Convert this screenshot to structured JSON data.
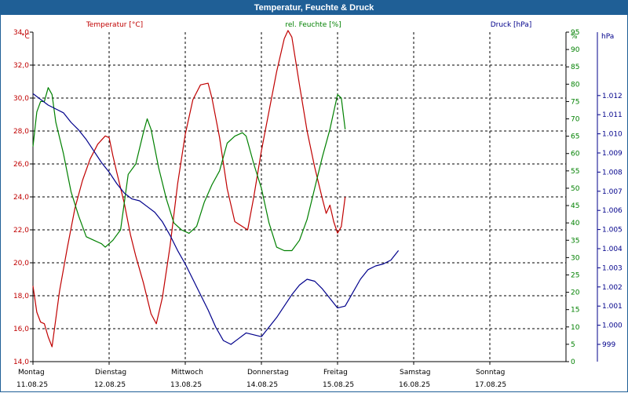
{
  "window": {
    "title": "Temperatur, Feuchte & Druck"
  },
  "chart_data": {
    "type": "line",
    "title": "Temperatur, Feuchte & Druck",
    "x": {
      "categories": [
        "Montag",
        "Dienstag",
        "Mittwoch",
        "Donnerstag",
        "Freitag",
        "Samstag",
        "Sonntag"
      ],
      "dates": [
        "11.08.25",
        "12.08.25",
        "13.08.25",
        "14.08.25",
        "15.08.25",
        "16.08.25",
        "17.08.25"
      ],
      "range_days": [
        0,
        7
      ]
    },
    "axes": {
      "temp": {
        "label": "Temperatur [°C]",
        "unit": "°C",
        "range": [
          14.0,
          34.0
        ],
        "step": 2.0,
        "ticks": [
          "14,0",
          "16,0",
          "18,0",
          "20,0",
          "22,0",
          "24,0",
          "26,0",
          "28,0",
          "30,0",
          "32,0",
          "34,0"
        ],
        "color": "#c00000"
      },
      "humidity": {
        "label": "rel. Feuchte [%]",
        "unit": "%",
        "range": [
          0,
          95
        ],
        "step": 5,
        "ticks": [
          "0",
          "5",
          "10",
          "15",
          "20",
          "25",
          "30",
          "35",
          "40",
          "45",
          "50",
          "55",
          "60",
          "65",
          "70",
          "75",
          "80",
          "85",
          "90",
          "95"
        ],
        "color": "#008000"
      },
      "pressure": {
        "label": "Druck [hPa]",
        "unit": "hPa",
        "range": [
          999,
          1012
        ],
        "step": 1,
        "ticks": [
          "999",
          "1.000",
          "1.001",
          "1.002",
          "1.003",
          "1.004",
          "1.005",
          "1.006",
          "1.007",
          "1.008",
          "1.009",
          "1.010",
          "1.011",
          "1.012"
        ],
        "color": "#00008b"
      }
    },
    "grid": true,
    "series": [
      {
        "name": "Temperatur [°C]",
        "axis": "temp",
        "color": "#c00000",
        "points": [
          [
            0,
            18.6
          ],
          [
            0.05,
            17.0
          ],
          [
            0.1,
            16.4
          ],
          [
            0.15,
            16.3
          ],
          [
            0.2,
            15.5
          ],
          [
            0.25,
            14.9
          ],
          [
            0.3,
            16.6
          ],
          [
            0.35,
            18.3
          ],
          [
            0.45,
            20.9
          ],
          [
            0.55,
            23.3
          ],
          [
            0.65,
            25.0
          ],
          [
            0.75,
            26.3
          ],
          [
            0.85,
            27.2
          ],
          [
            0.95,
            27.7
          ],
          [
            1.0,
            27.6
          ],
          [
            1.05,
            26.5
          ],
          [
            1.1,
            25.5
          ],
          [
            1.2,
            23.6
          ],
          [
            1.28,
            21.7
          ],
          [
            1.35,
            20.4
          ],
          [
            1.45,
            18.8
          ],
          [
            1.55,
            16.9
          ],
          [
            1.62,
            16.3
          ],
          [
            1.7,
            17.9
          ],
          [
            1.8,
            21.0
          ],
          [
            1.9,
            24.8
          ],
          [
            2.0,
            27.8
          ],
          [
            2.1,
            29.9
          ],
          [
            2.2,
            30.8
          ],
          [
            2.3,
            30.9
          ],
          [
            2.35,
            30.0
          ],
          [
            2.45,
            27.6
          ],
          [
            2.55,
            24.5
          ],
          [
            2.65,
            22.5
          ],
          [
            2.75,
            22.2
          ],
          [
            2.82,
            22.0
          ],
          [
            2.9,
            24.0
          ],
          [
            3.0,
            26.8
          ],
          [
            3.1,
            29.2
          ],
          [
            3.2,
            31.6
          ],
          [
            3.3,
            33.6
          ],
          [
            3.35,
            34.1
          ],
          [
            3.4,
            33.7
          ],
          [
            3.5,
            30.8
          ],
          [
            3.6,
            28.0
          ],
          [
            3.7,
            25.8
          ],
          [
            3.8,
            23.9
          ],
          [
            3.85,
            23.0
          ],
          [
            3.9,
            23.5
          ],
          [
            3.95,
            22.5
          ],
          [
            4.0,
            21.8
          ],
          [
            4.05,
            22.2
          ],
          [
            4.1,
            24.0
          ]
        ]
      },
      {
        "name": "rel. Feuchte [%]",
        "axis": "humidity",
        "color": "#008000",
        "points": [
          [
            0,
            62
          ],
          [
            0.05,
            72
          ],
          [
            0.1,
            75
          ],
          [
            0.15,
            75
          ],
          [
            0.2,
            79
          ],
          [
            0.25,
            77
          ],
          [
            0.3,
            69
          ],
          [
            0.4,
            60
          ],
          [
            0.5,
            49
          ],
          [
            0.6,
            42
          ],
          [
            0.7,
            36
          ],
          [
            0.8,
            35
          ],
          [
            0.9,
            34
          ],
          [
            0.95,
            33
          ],
          [
            1.05,
            35
          ],
          [
            1.15,
            38
          ],
          [
            1.25,
            54
          ],
          [
            1.35,
            57
          ],
          [
            1.45,
            66
          ],
          [
            1.5,
            70
          ],
          [
            1.55,
            67
          ],
          [
            1.65,
            56
          ],
          [
            1.75,
            47
          ],
          [
            1.85,
            40
          ],
          [
            1.95,
            38
          ],
          [
            2.05,
            37
          ],
          [
            2.15,
            39
          ],
          [
            2.25,
            46
          ],
          [
            2.35,
            51
          ],
          [
            2.45,
            55
          ],
          [
            2.55,
            63
          ],
          [
            2.65,
            65
          ],
          [
            2.75,
            66
          ],
          [
            2.8,
            65
          ],
          [
            2.9,
            57
          ],
          [
            3.0,
            50
          ],
          [
            3.1,
            40
          ],
          [
            3.2,
            33
          ],
          [
            3.3,
            32
          ],
          [
            3.4,
            32
          ],
          [
            3.5,
            35
          ],
          [
            3.6,
            41
          ],
          [
            3.7,
            50
          ],
          [
            3.8,
            59
          ],
          [
            3.9,
            67
          ],
          [
            3.95,
            72
          ],
          [
            4.0,
            77
          ],
          [
            4.05,
            76
          ],
          [
            4.1,
            67
          ]
        ]
      },
      {
        "name": "Druck [hPa]",
        "axis": "pressure",
        "color": "#00008b",
        "points": [
          [
            0,
            1012.1
          ],
          [
            0.1,
            1011.8
          ],
          [
            0.2,
            1011.5
          ],
          [
            0.3,
            1011.3
          ],
          [
            0.4,
            1011.1
          ],
          [
            0.5,
            1010.6
          ],
          [
            0.6,
            1010.2
          ],
          [
            0.7,
            1009.7
          ],
          [
            0.8,
            1009.1
          ],
          [
            0.9,
            1008.5
          ],
          [
            1.0,
            1008.0
          ],
          [
            1.1,
            1007.4
          ],
          [
            1.2,
            1006.9
          ],
          [
            1.3,
            1006.6
          ],
          [
            1.4,
            1006.5
          ],
          [
            1.5,
            1006.2
          ],
          [
            1.6,
            1005.9
          ],
          [
            1.7,
            1005.4
          ],
          [
            1.8,
            1004.7
          ],
          [
            1.9,
            1003.9
          ],
          [
            2.0,
            1003.2
          ],
          [
            2.1,
            1002.4
          ],
          [
            2.2,
            1001.6
          ],
          [
            2.3,
            1000.8
          ],
          [
            2.4,
            999.9
          ],
          [
            2.5,
            999.2
          ],
          [
            2.6,
            999.0
          ],
          [
            2.7,
            999.3
          ],
          [
            2.8,
            999.6
          ],
          [
            2.9,
            999.5
          ],
          [
            3.0,
            999.4
          ],
          [
            3.1,
            999.9
          ],
          [
            3.2,
            1000.4
          ],
          [
            3.3,
            1001.0
          ],
          [
            3.4,
            1001.6
          ],
          [
            3.5,
            1002.1
          ],
          [
            3.6,
            1002.4
          ],
          [
            3.7,
            1002.3
          ],
          [
            3.8,
            1001.9
          ],
          [
            3.9,
            1001.4
          ],
          [
            4.0,
            1000.9
          ],
          [
            4.1,
            1001.0
          ],
          [
            4.2,
            1001.7
          ],
          [
            4.3,
            1002.4
          ],
          [
            4.4,
            1002.9
          ],
          [
            4.5,
            1003.1
          ],
          [
            4.6,
            1003.2
          ],
          [
            4.7,
            1003.4
          ],
          [
            4.8,
            1003.9
          ]
        ]
      }
    ]
  }
}
